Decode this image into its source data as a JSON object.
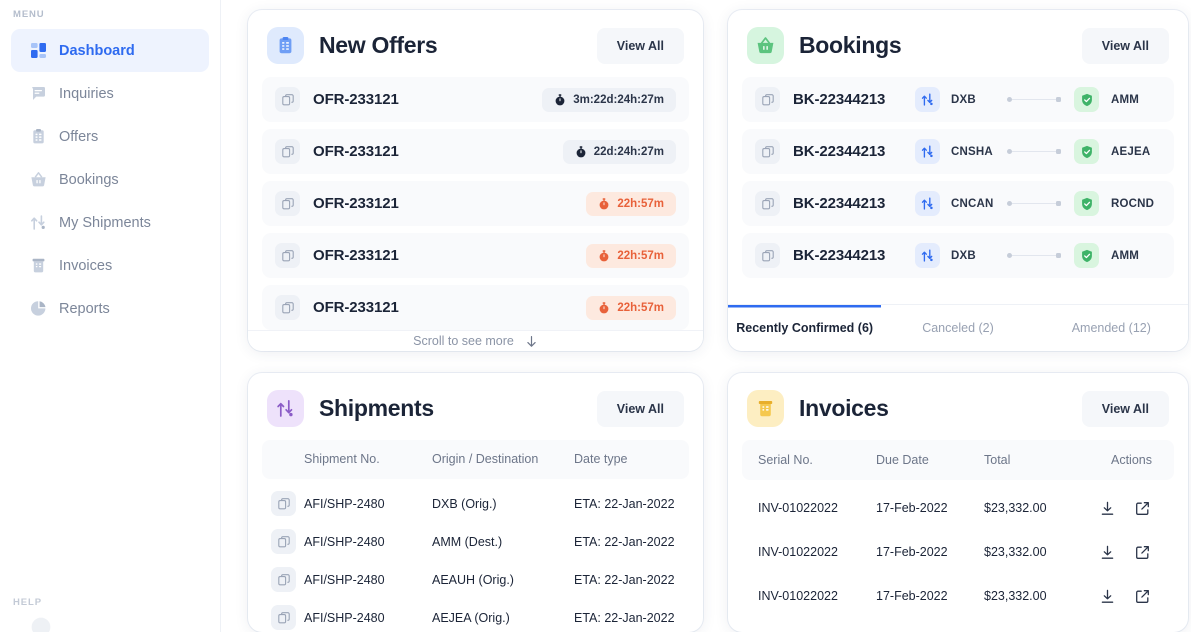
{
  "sidebar": {
    "menu_label": "MENU",
    "help_label": "HELP",
    "items": [
      {
        "label": "Dashboard",
        "icon": "dashboard-icon",
        "active": true
      },
      {
        "label": "Inquiries",
        "icon": "inquiries-icon",
        "active": false
      },
      {
        "label": "Offers",
        "icon": "offers-icon",
        "active": false
      },
      {
        "label": "Bookings",
        "icon": "bookings-icon",
        "active": false
      },
      {
        "label": "My Shipments",
        "icon": "shipments-icon",
        "active": false
      },
      {
        "label": "Invoices",
        "icon": "invoices-icon",
        "active": false
      },
      {
        "label": "Reports",
        "icon": "reports-icon",
        "active": false
      }
    ]
  },
  "offers_card": {
    "title": "New Offers",
    "icon": "clipboard-icon",
    "view_all": "View All",
    "scroll_hint": "Scroll to see more",
    "rows": [
      {
        "id": "OFR-233121",
        "timer": "3m:22d:24h:27m",
        "state": "normal"
      },
      {
        "id": "OFR-233121",
        "timer": "22d:24h:27m",
        "state": "normal"
      },
      {
        "id": "OFR-233121",
        "timer": "22h:57m",
        "state": "warn"
      },
      {
        "id": "OFR-233121",
        "timer": "22h:57m",
        "state": "warn"
      },
      {
        "id": "OFR-233121",
        "timer": "22h:57m",
        "state": "warn"
      }
    ]
  },
  "bookings_card": {
    "title": "Bookings",
    "icon": "basket-icon",
    "view_all": "View All",
    "rows": [
      {
        "id": "BK-22344213",
        "origin": "DXB",
        "destination": "AMM"
      },
      {
        "id": "BK-22344213",
        "origin": "CNSHA",
        "destination": "AEJEA"
      },
      {
        "id": "BK-22344213",
        "origin": "CNCAN",
        "destination": "ROCND"
      },
      {
        "id": "BK-22344213",
        "origin": "DXB",
        "destination": "AMM"
      }
    ],
    "tabs": [
      {
        "label": "Recently Confirmed (6)",
        "active": true
      },
      {
        "label": "Canceled (2)",
        "active": false
      },
      {
        "label": "Amended (12)",
        "active": false
      }
    ]
  },
  "shipments_card": {
    "title": "Shipments",
    "icon": "transfer-icon",
    "view_all": "View All",
    "columns": [
      "Shipment No.",
      "Origin / Destination",
      "Date type"
    ],
    "rows": [
      {
        "no": "AFI/SHP-2480",
        "od": "DXB (Orig.)",
        "date": "ETA: 22-Jan-2022"
      },
      {
        "no": "AFI/SHP-2480",
        "od": "AMM (Dest.)",
        "date": "ETA: 22-Jan-2022"
      },
      {
        "no": "AFI/SHP-2480",
        "od": "AEAUH (Orig.)",
        "date": "ETA: 22-Jan-2022"
      },
      {
        "no": "AFI/SHP-2480",
        "od": "AEJEA (Orig.)",
        "date": "ETA: 22-Jan-2022"
      }
    ]
  },
  "invoices_card": {
    "title": "Invoices",
    "icon": "invoice-icon",
    "view_all": "View All",
    "columns": [
      "Serial No.",
      "Due Date",
      "Total",
      "Actions"
    ],
    "rows": [
      {
        "serial": "INV-01022022",
        "due": "17-Feb-2022",
        "total": "$23,332.00"
      },
      {
        "serial": "INV-01022022",
        "due": "17-Feb-2022",
        "total": "$23,332.00"
      },
      {
        "serial": "INV-01022022",
        "due": "17-Feb-2022",
        "total": "$23,332.00"
      }
    ],
    "actions": [
      "download-icon",
      "open-external-icon"
    ]
  },
  "colors": {
    "accent": "#2f6bf0",
    "offers_icon_bg": "#dfeafd",
    "bookings_icon_bg": "#d6f5df",
    "shipments_icon_bg": "#eee2fb",
    "invoices_icon_bg": "#fdeec2",
    "warn_bg": "#fde9df",
    "warn_fg": "#e8613a",
    "ok_bg": "#d9f5df",
    "ok_fg": "#3eb368"
  }
}
